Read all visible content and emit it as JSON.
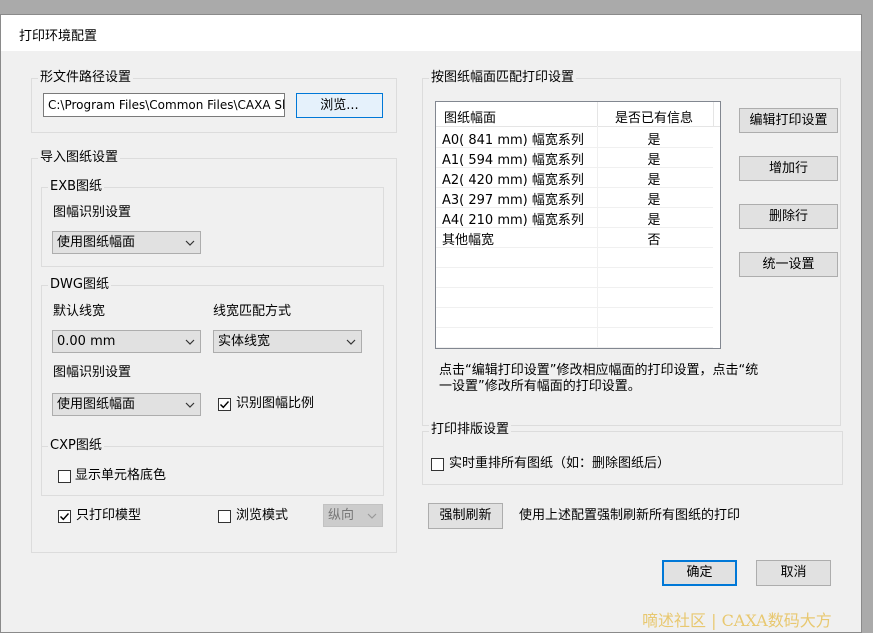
{
  "dialog": {
    "title": "打印环境配置"
  },
  "shape_path": {
    "group_label": "形文件路径设置",
    "path_value": "C:\\Program Files\\Common Files\\CAXA Sh",
    "browse_label": "浏览..."
  },
  "import": {
    "group_label": "导入图纸设置",
    "exb": {
      "label": "EXB图纸",
      "frame_recog_label": "图幅识别设置",
      "frame_recog_value": "使用图纸幅面"
    },
    "dwg": {
      "label": "DWG图纸",
      "default_linewidth_label": "默认线宽",
      "default_linewidth_value": "0.00 mm",
      "linewidth_match_label": "线宽匹配方式",
      "linewidth_match_value": "实体线宽",
      "frame_recog_label": "图幅识别设置",
      "frame_recog_value": "使用图纸幅面",
      "recog_scale_label": "识别图幅比例",
      "recog_scale_checked": true
    },
    "cxp": {
      "label": "CXP图纸",
      "show_cell_bg_label": "显示单元格底色",
      "show_cell_bg_checked": false
    },
    "only_print_model_label": "只打印模型",
    "only_print_model_checked": true,
    "browse_mode_label": "浏览模式",
    "browse_mode_checked": false,
    "orientation_value": "纵向"
  },
  "match": {
    "group_label": "按图纸幅面匹配打印设置",
    "columns": [
      "图纸幅面",
      "是否已有信息"
    ],
    "rows": [
      {
        "size": "A0( 841 mm) 幅宽系列",
        "has_info": "是"
      },
      {
        "size": "A1( 594 mm) 幅宽系列",
        "has_info": "是"
      },
      {
        "size": "A2( 420 mm) 幅宽系列",
        "has_info": "是"
      },
      {
        "size": "A3( 297 mm) 幅宽系列",
        "has_info": "是"
      },
      {
        "size": "A4( 210 mm) 幅宽系列",
        "has_info": "是"
      },
      {
        "size": "其他幅宽",
        "has_info": "否"
      }
    ],
    "edit_btn": "编辑打印设置",
    "add_row_btn": "增加行",
    "delete_row_btn": "删除行",
    "unify_btn": "统一设置",
    "hint_line1": "点击“编辑打印设置”修改相应幅面的打印设置，点击“统",
    "hint_line2": "一设置”修改所有幅面的打印设置。"
  },
  "layout_settings": {
    "group_label": "打印排版设置",
    "realtime_label": "实时重排所有图纸（如：删除图纸后）",
    "realtime_checked": false
  },
  "force_refresh": {
    "button_label": "强制刷新",
    "description": "使用上述配置强制刷新所有图纸的打印"
  },
  "footer": {
    "ok_label": "确定",
    "cancel_label": "取消"
  },
  "watermark": "嘀述社区 | CAXA数码大方",
  "colors": {
    "accent": "#0078d7",
    "dialog_bg": "#f0f0f0",
    "button_bg": "#e1e1e1"
  }
}
